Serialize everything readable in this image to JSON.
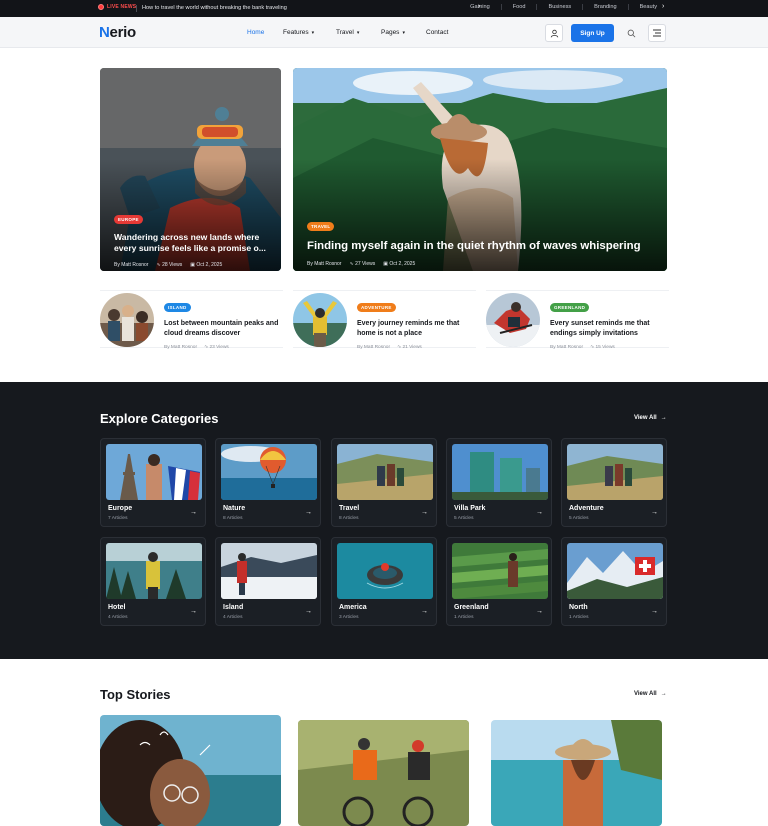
{
  "topbar": {
    "live_label": "LIVE NEWS",
    "ticker": "How to travel the world without breaking the bank traveling",
    "links": [
      "Gaming",
      "Food",
      "Business",
      "Branding",
      "Beauty"
    ],
    "prev_arrow": "›",
    "next_arrow": "›"
  },
  "nav": {
    "logo_first": "N",
    "logo_rest": "erio",
    "menu": {
      "home": "Home",
      "features": "Features",
      "travel": "Travel",
      "pages": "Pages",
      "contact": "Contact"
    },
    "caret": "⌄",
    "signup": "Sign Up",
    "accent": "#1a73e8"
  },
  "hero": {
    "left": {
      "tag": "EUROPE",
      "title": "Wandering across new lands where every sunrise feels like a promise o...",
      "author": "By Matt Rosnor",
      "views": "28 Views",
      "date": "Oct 2, 2025"
    },
    "right": {
      "tag": "TRAVEL",
      "title": "Finding myself again in the quiet rhythm of waves whispering",
      "author": "By Matt Rosnor",
      "views": "27 Views",
      "date": "Oct 2, 2025"
    }
  },
  "mini_posts": [
    {
      "tag": "ISLAND",
      "title": "Lost between mountain peaks and cloud dreams discover",
      "author": "By Matt Rosnor",
      "views": "23 Views"
    },
    {
      "tag": "ADVENTURE",
      "title": "Every journey reminds me that home is not a place",
      "author": "By Matt Rosnor",
      "views": "21 Views"
    },
    {
      "tag": "GREENLAND",
      "title": "Every sunset reminds me that endings simply invitations",
      "author": "By Matt Rosnor",
      "views": "15 Views"
    }
  ],
  "categories": {
    "title": "Explore Categories",
    "view_all": "View All",
    "items": [
      {
        "name": "Europe",
        "count": "7 Articles"
      },
      {
        "name": "Nature",
        "count": "8 Articles"
      },
      {
        "name": "Travel",
        "count": "8 Articles"
      },
      {
        "name": "Villa Park",
        "count": "5 Articles"
      },
      {
        "name": "Adventure",
        "count": "5 Articles"
      },
      {
        "name": "Hotel",
        "count": "4 Articles"
      },
      {
        "name": "Island",
        "count": "4 Articles"
      },
      {
        "name": "America",
        "count": "3 Articles"
      },
      {
        "name": "Greenland",
        "count": "1 Articles"
      },
      {
        "name": "North",
        "count": "1 Articles"
      }
    ]
  },
  "top_stories": {
    "title": "Top Stories",
    "view_all": "View All"
  }
}
